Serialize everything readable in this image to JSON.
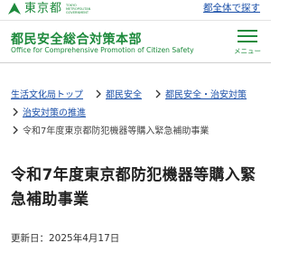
{
  "brand": {
    "logo_text": "東京都",
    "logo_subtext": "TOKYO METROPOLITAN GOVERNMENT"
  },
  "top_link": "都全体で探す",
  "header": {
    "title": "都民安全総合対策本部",
    "subtitle": "Office for Comprehensive Promotion of Citizen Safety",
    "menu_label": "メニュー"
  },
  "breadcrumb": [
    {
      "label": "生活文化局トップ",
      "link": true
    },
    {
      "label": "都民安全",
      "link": true
    },
    {
      "label": "都民安全・治安対策",
      "link": true
    },
    {
      "label": "治安対策の推進",
      "link": true
    },
    {
      "label": "令和7年度東京都防犯機器等購入緊急補助事業",
      "link": false
    }
  ],
  "page": {
    "title": "令和7年度東京都防犯機器等購入緊急補助事業",
    "updated": "更新日：2025年4月17日"
  },
  "colors": {
    "brand_green": "#1d8a3c",
    "link_blue": "#1a4fa8"
  }
}
